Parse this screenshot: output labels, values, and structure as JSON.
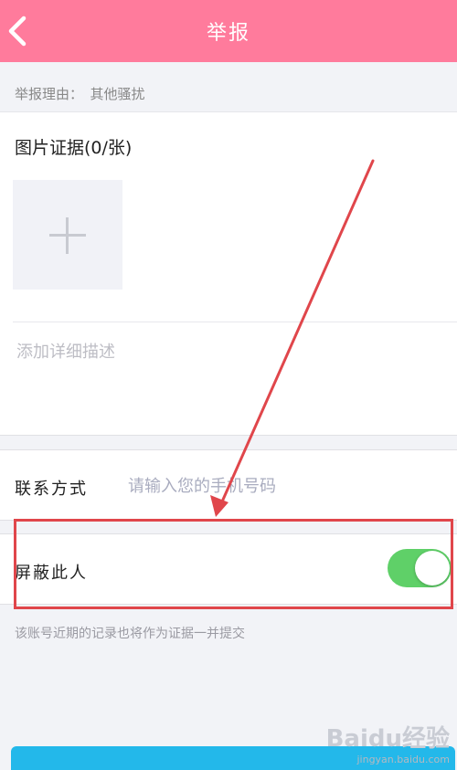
{
  "header": {
    "title": "举报"
  },
  "report": {
    "reason": "举报理由：　其他骚扰"
  },
  "evidence": {
    "photo_title": "图片证据(0/张)",
    "description_placeholder": "添加详细描述"
  },
  "contact": {
    "label": "联系方式",
    "placeholder": "请输入您的手机号码"
  },
  "block": {
    "label": "屏蔽此人",
    "enabled": true,
    "hint": "该账号近期的记录也将作为证据一并提交"
  },
  "watermark": {
    "logo": "Baidu经验",
    "url": "jingyan.baidu.com"
  },
  "colors": {
    "header": "#ff7b9c",
    "toggle_on": "#5fd068",
    "annotation": "#e0464b",
    "submit": "#23b8ea"
  }
}
